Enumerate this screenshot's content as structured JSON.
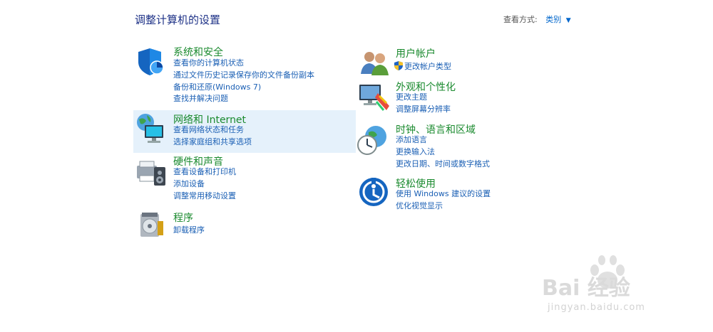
{
  "header": {
    "title": "调整计算机的设置",
    "view_by_label": "查看方式:",
    "view_by_value": "类别"
  },
  "left": [
    {
      "title": "系统和安全",
      "icon": "system-security-icon",
      "links": [
        "查看你的计算机状态",
        "通过文件历史记录保存你的文件备份副本",
        "备份和还原(Windows 7)",
        "查找并解决问题"
      ]
    },
    {
      "title": "网络和 Internet",
      "icon": "network-internet-icon",
      "links": [
        "查看网络状态和任务",
        "选择家庭组和共享选项"
      ]
    },
    {
      "title": "硬件和声音",
      "icon": "hardware-sound-icon",
      "links": [
        "查看设备和打印机",
        "添加设备",
        "调整常用移动设置"
      ]
    },
    {
      "title": "程序",
      "icon": "programs-icon",
      "links": [
        "卸载程序"
      ]
    }
  ],
  "right": [
    {
      "title": "用户帐户",
      "icon": "user-accounts-icon",
      "links": [
        "更改帐户类型"
      ]
    },
    {
      "title": "外观和个性化",
      "icon": "appearance-icon",
      "links": [
        "更改主题",
        "调整屏幕分辨率"
      ]
    },
    {
      "title": "时钟、语言和区域",
      "icon": "clock-region-icon",
      "links": [
        "添加语言",
        "更换输入法",
        "更改日期、时间或数字格式"
      ]
    },
    {
      "title": "轻松使用",
      "icon": "ease-of-access-icon",
      "links": [
        "使用 Windows 建议的设置",
        "优化视觉显示"
      ]
    }
  ],
  "watermark": {
    "main": "Bai 经验",
    "sub": "jingyan.baidu.com"
  },
  "colors": {
    "title": "#1e3287",
    "category": "#1a8a2e",
    "link": "#1a5fb4",
    "highlight": "#e5f1fb"
  }
}
